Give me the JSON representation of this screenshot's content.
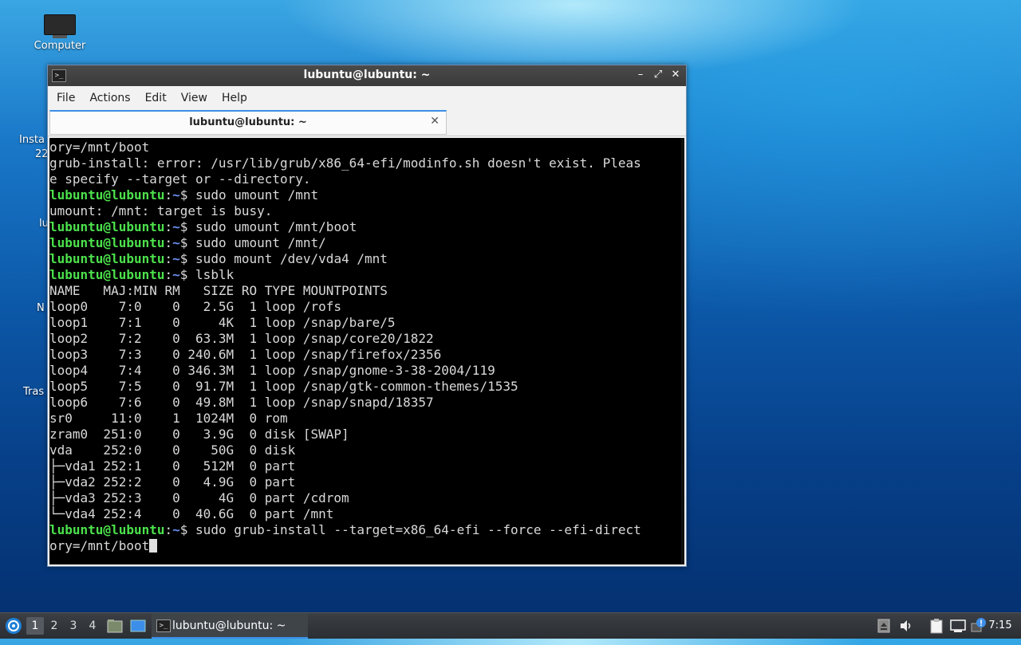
{
  "desktop": {
    "computer_label": "Computer",
    "partial_labels": [
      "Insta",
      "22",
      "lu",
      "N",
      "Tras"
    ]
  },
  "window": {
    "title": "lubuntu@lubuntu: ~",
    "menu": [
      "File",
      "Actions",
      "Edit",
      "View",
      "Help"
    ],
    "tab_title": "lubuntu@lubuntu: ~"
  },
  "terminal": {
    "prompt_user": "lubuntu@lubuntu",
    "prompt_colon": ":",
    "prompt_path": "~",
    "prompt_dollar": "$ ",
    "lines": [
      {
        "out": "ory=/mnt/boot"
      },
      {
        "out": "grub-install: error: /usr/lib/grub/x86_64-efi/modinfo.sh doesn't exist. Pleas"
      },
      {
        "out": "e specify --target or --directory."
      },
      {
        "cmd": "sudo umount /mnt"
      },
      {
        "out": "umount: /mnt: target is busy."
      },
      {
        "cmd": "sudo umount /mnt/boot"
      },
      {
        "cmd": "sudo umount /mnt/"
      },
      {
        "cmd": "sudo mount /dev/vda4 /mnt"
      },
      {
        "cmd": "lsblk"
      },
      {
        "out": "NAME   MAJ:MIN RM   SIZE RO TYPE MOUNTPOINTS"
      },
      {
        "out": "loop0    7:0    0   2.5G  1 loop /rofs"
      },
      {
        "out": "loop1    7:1    0     4K  1 loop /snap/bare/5"
      },
      {
        "out": "loop2    7:2    0  63.3M  1 loop /snap/core20/1822"
      },
      {
        "out": "loop3    7:3    0 240.6M  1 loop /snap/firefox/2356"
      },
      {
        "out": "loop4    7:4    0 346.3M  1 loop /snap/gnome-3-38-2004/119"
      },
      {
        "out": "loop5    7:5    0  91.7M  1 loop /snap/gtk-common-themes/1535"
      },
      {
        "out": "loop6    7:6    0  49.8M  1 loop /snap/snapd/18357"
      },
      {
        "out": "sr0     11:0    1  1024M  0 rom"
      },
      {
        "out": "zram0  251:0    0   3.9G  0 disk [SWAP]"
      },
      {
        "out": "vda    252:0    0    50G  0 disk"
      },
      {
        "out": "├─vda1 252:1    0   512M  0 part"
      },
      {
        "out": "├─vda2 252:2    0   4.9G  0 part"
      },
      {
        "out": "├─vda3 252:3    0     4G  0 part /cdrom"
      },
      {
        "out": "└─vda4 252:4    0  40.6G  0 part /mnt"
      },
      {
        "cmd": "sudo grub-install --target=x86_64-efi --force --efi-direct"
      },
      {
        "out": "ory=/mnt/boot",
        "cursor": true
      }
    ]
  },
  "taskbar": {
    "workspaces": [
      "1",
      "2",
      "3",
      "4"
    ],
    "active_workspace": "1",
    "task_label": "lubuntu@lubuntu: ~",
    "clock": "7:15"
  },
  "colors": {
    "prompt_user": "#4ce24c",
    "prompt_path": "#6a8ff0",
    "accent": "#3d8ee8"
  }
}
